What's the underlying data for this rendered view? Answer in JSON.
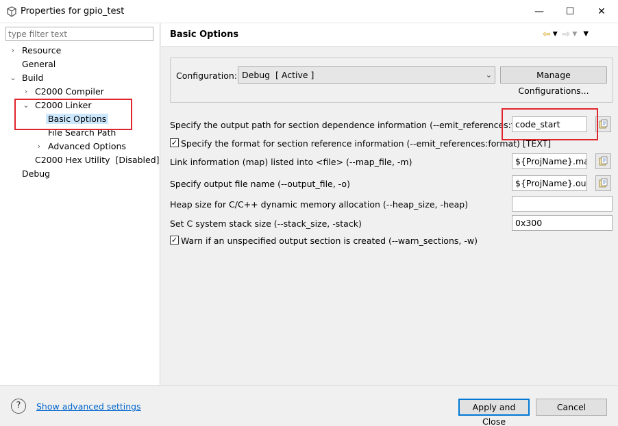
{
  "window": {
    "title": "Properties for gpio_test",
    "minimize": "—",
    "maximize": "☐",
    "close": "✕"
  },
  "filter": {
    "placeholder": "type filter text",
    "value": ""
  },
  "tree": {
    "resource": "Resource",
    "general": "General",
    "build": "Build",
    "compiler": "C2000 Compiler",
    "linker": "C2000 Linker",
    "basic_options": "Basic Options",
    "file_search_path": "File Search Path",
    "advanced_options": "Advanced Options",
    "hex_utility": "C2000 Hex Utility  [Disabled]",
    "debug": "Debug"
  },
  "page": {
    "title": "Basic Options"
  },
  "configuration": {
    "label": "Configuration:",
    "value": "Debug  [ Active ]",
    "manage_label": "Manage Configurations..."
  },
  "options": {
    "emit_references_label": "Specify the output path for section dependence information (--emit_references:file)",
    "emit_references_value": "code_start",
    "emit_format_label": "Specify the format for section reference information (--emit_references:format) [TEXT]",
    "emit_format_checked": true,
    "map_file_label": "Link information (map) listed into <file> (--map_file, -m)",
    "map_file_value": "${ProjName}.map",
    "output_file_label": "Specify output file name (--output_file, -o)",
    "output_file_value": "${ProjName}.out",
    "heap_size_label": "Heap size for C/C++ dynamic memory allocation (--heap_size, -heap)",
    "heap_size_value": "",
    "stack_size_label": "Set C system stack size (--stack_size, -stack)",
    "stack_size_value": "0x300",
    "warn_sections_label": "Warn if an unspecified output section is created (--warn_sections, -w)",
    "warn_sections_checked": true
  },
  "footer": {
    "help": "?",
    "advanced_link": "Show advanced settings",
    "apply_close": "Apply and Close",
    "cancel": "Cancel"
  },
  "colors": {
    "accent": "#0078d7",
    "highlight": "#e0242c",
    "link": "#0066cc",
    "selection": "#cce8ff"
  },
  "icons": [
    "app-icon",
    "chevron-right-icon",
    "chevron-down-icon",
    "back-arrow-icon",
    "forward-arrow-icon",
    "menu-icon",
    "browse-icon",
    "checkbox-check-icon",
    "help-icon"
  ]
}
